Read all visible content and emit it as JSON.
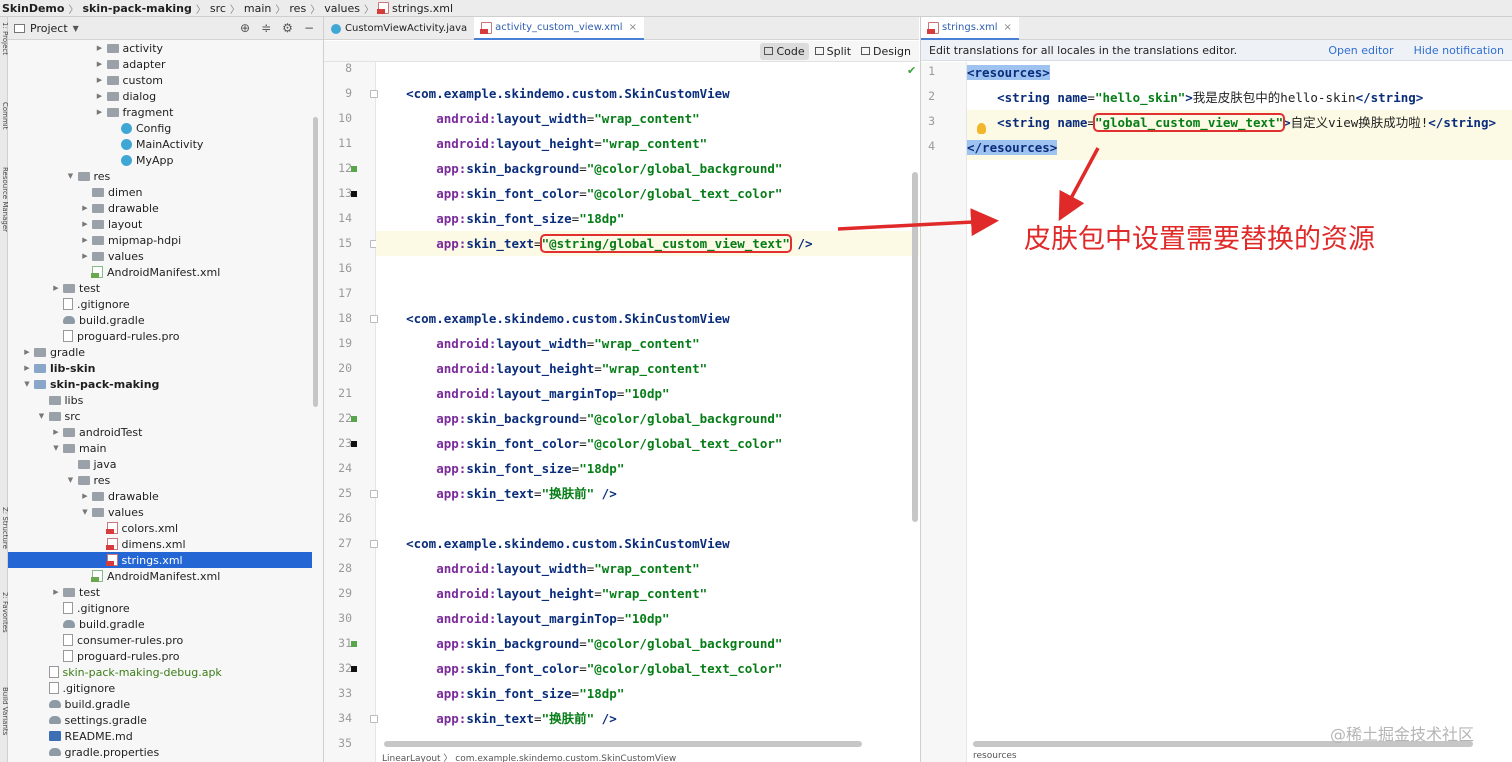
{
  "breadcrumb": [
    "SkinDemo",
    "skin-pack-making",
    "src",
    "main",
    "res",
    "values",
    "strings.xml"
  ],
  "left_strip": [
    "1: Project",
    "Commit",
    "Resource Manager",
    "Z: Structure",
    "2: Favorites",
    "Build Variants"
  ],
  "project_panel": {
    "title": "Project",
    "tree": [
      {
        "label": "activity",
        "indent": 5,
        "arrow": "▶",
        "icon": "folder"
      },
      {
        "label": "adapter",
        "indent": 5,
        "arrow": "▶",
        "icon": "folder"
      },
      {
        "label": "custom",
        "indent": 5,
        "arrow": "▶",
        "icon": "folder"
      },
      {
        "label": "dialog",
        "indent": 5,
        "arrow": "▶",
        "icon": "folder"
      },
      {
        "label": "fragment",
        "indent": 5,
        "arrow": "▶",
        "icon": "folder"
      },
      {
        "label": "Config",
        "indent": 6,
        "arrow": "",
        "icon": "class"
      },
      {
        "label": "MainActivity",
        "indent": 6,
        "arrow": "",
        "icon": "class"
      },
      {
        "label": "MyApp",
        "indent": 6,
        "arrow": "",
        "icon": "class"
      },
      {
        "label": "res",
        "indent": 3,
        "arrow": "▼",
        "icon": "folder"
      },
      {
        "label": "dimen",
        "indent": 4,
        "arrow": "",
        "icon": "folder"
      },
      {
        "label": "drawable",
        "indent": 4,
        "arrow": "▶",
        "icon": "folder"
      },
      {
        "label": "layout",
        "indent": 4,
        "arrow": "▶",
        "icon": "folder"
      },
      {
        "label": "mipmap-hdpi",
        "indent": 4,
        "arrow": "▶",
        "icon": "folder"
      },
      {
        "label": "values",
        "indent": 4,
        "arrow": "▶",
        "icon": "folder"
      },
      {
        "label": "AndroidManifest.xml",
        "indent": 4,
        "arrow": "",
        "icon": "manifest"
      },
      {
        "label": "test",
        "indent": 2,
        "arrow": "▶",
        "icon": "folder"
      },
      {
        "label": ".gitignore",
        "indent": 2,
        "arrow": "",
        "icon": "file"
      },
      {
        "label": "build.gradle",
        "indent": 2,
        "arrow": "",
        "icon": "gradle"
      },
      {
        "label": "proguard-rules.pro",
        "indent": 2,
        "arrow": "",
        "icon": "file"
      },
      {
        "label": "gradle",
        "indent": 0,
        "arrow": "▶",
        "icon": "folder"
      },
      {
        "label": "lib-skin",
        "indent": 0,
        "arrow": "▶",
        "icon": "folderm",
        "bold": true
      },
      {
        "label": "skin-pack-making",
        "indent": 0,
        "arrow": "▼",
        "icon": "folderm",
        "bold": true
      },
      {
        "label": "libs",
        "indent": 1,
        "arrow": "",
        "icon": "folder"
      },
      {
        "label": "src",
        "indent": 1,
        "arrow": "▼",
        "icon": "folder"
      },
      {
        "label": "androidTest",
        "indent": 2,
        "arrow": "▶",
        "icon": "folder"
      },
      {
        "label": "main",
        "indent": 2,
        "arrow": "▼",
        "icon": "folder"
      },
      {
        "label": "java",
        "indent": 3,
        "arrow": "",
        "icon": "folder"
      },
      {
        "label": "res",
        "indent": 3,
        "arrow": "▼",
        "icon": "folder"
      },
      {
        "label": "drawable",
        "indent": 4,
        "arrow": "▶",
        "icon": "folder"
      },
      {
        "label": "values",
        "indent": 4,
        "arrow": "▼",
        "icon": "folder"
      },
      {
        "label": "colors.xml",
        "indent": 5,
        "arrow": "",
        "icon": "xml"
      },
      {
        "label": "dimens.xml",
        "indent": 5,
        "arrow": "",
        "icon": "xml"
      },
      {
        "label": "strings.xml",
        "indent": 5,
        "arrow": "",
        "icon": "xml",
        "selected": true
      },
      {
        "label": "AndroidManifest.xml",
        "indent": 4,
        "arrow": "",
        "icon": "manifest"
      },
      {
        "label": "test",
        "indent": 2,
        "arrow": "▶",
        "icon": "folder"
      },
      {
        "label": ".gitignore",
        "indent": 2,
        "arrow": "",
        "icon": "file"
      },
      {
        "label": "build.gradle",
        "indent": 2,
        "arrow": "",
        "icon": "gradle"
      },
      {
        "label": "consumer-rules.pro",
        "indent": 2,
        "arrow": "",
        "icon": "file"
      },
      {
        "label": "proguard-rules.pro",
        "indent": 2,
        "arrow": "",
        "icon": "file"
      },
      {
        "label": "skin-pack-making-debug.apk",
        "indent": 1,
        "arrow": "",
        "icon": "file",
        "green": true
      },
      {
        "label": ".gitignore",
        "indent": 1,
        "arrow": "",
        "icon": "file"
      },
      {
        "label": "build.gradle",
        "indent": 1,
        "arrow": "",
        "icon": "gradle"
      },
      {
        "label": "settings.gradle",
        "indent": 1,
        "arrow": "",
        "icon": "gradle"
      },
      {
        "label": "README.md",
        "indent": 1,
        "arrow": "",
        "icon": "md"
      },
      {
        "label": "gradle.properties",
        "indent": 1,
        "arrow": "",
        "icon": "gradle"
      }
    ]
  },
  "editor": {
    "tabs": [
      {
        "label": "CustomViewActivity.java",
        "active": false,
        "icon": "java"
      },
      {
        "label": "activity_custom_view.xml",
        "active": true,
        "icon": "xml"
      }
    ],
    "modes": [
      "Code",
      "Split",
      "Design"
    ],
    "active_mode": "Code",
    "lines": [
      {
        "n": "8",
        "parts": []
      },
      {
        "n": "9",
        "parts": [
          [
            "tag",
            "    <com.example.skindemo.custom.SkinCustomView"
          ]
        ]
      },
      {
        "n": "10",
        "parts": [
          [
            "ns",
            "        android:"
          ],
          [
            "attr",
            "layout_width"
          ],
          [
            "txt",
            "="
          ],
          [
            "val",
            "\"wrap_content\""
          ]
        ]
      },
      {
        "n": "11",
        "parts": [
          [
            "ns",
            "        android:"
          ],
          [
            "attr",
            "layout_height"
          ],
          [
            "txt",
            "="
          ],
          [
            "val",
            "\"wrap_content\""
          ]
        ]
      },
      {
        "n": "12",
        "parts": [
          [
            "ns",
            "        app:"
          ],
          [
            "attr",
            "skin_background"
          ],
          [
            "txt",
            "="
          ],
          [
            "val",
            "\"@color/global_background\""
          ]
        ],
        "marker": "green"
      },
      {
        "n": "13",
        "parts": [
          [
            "ns",
            "        app:"
          ],
          [
            "attr",
            "skin_font_color"
          ],
          [
            "txt",
            "="
          ],
          [
            "val",
            "\"@color/global_text_color\""
          ]
        ],
        "marker": "black"
      },
      {
        "n": "14",
        "parts": [
          [
            "ns",
            "        app:"
          ],
          [
            "attr",
            "skin_font_size"
          ],
          [
            "txt",
            "="
          ],
          [
            "val",
            "\"18dp\""
          ]
        ]
      },
      {
        "n": "15",
        "parts": [
          [
            "ns",
            "        app:"
          ],
          [
            "attr",
            "skin_text"
          ],
          [
            "txt",
            "="
          ],
          [
            "val box",
            "\"@string/global_custom_view_text\""
          ],
          [
            "tag",
            " />"
          ]
        ],
        "current": true
      },
      {
        "n": "16",
        "parts": []
      },
      {
        "n": "17",
        "parts": []
      },
      {
        "n": "18",
        "parts": [
          [
            "tag",
            "    <com.example.skindemo.custom.SkinCustomView"
          ]
        ]
      },
      {
        "n": "19",
        "parts": [
          [
            "ns",
            "        android:"
          ],
          [
            "attr",
            "layout_width"
          ],
          [
            "txt",
            "="
          ],
          [
            "val",
            "\"wrap_content\""
          ]
        ]
      },
      {
        "n": "20",
        "parts": [
          [
            "ns",
            "        android:"
          ],
          [
            "attr",
            "layout_height"
          ],
          [
            "txt",
            "="
          ],
          [
            "val",
            "\"wrap_content\""
          ]
        ]
      },
      {
        "n": "21",
        "parts": [
          [
            "ns",
            "        android:"
          ],
          [
            "attr",
            "layout_marginTop"
          ],
          [
            "txt",
            "="
          ],
          [
            "val",
            "\"10dp\""
          ]
        ]
      },
      {
        "n": "22",
        "parts": [
          [
            "ns",
            "        app:"
          ],
          [
            "attr",
            "skin_background"
          ],
          [
            "txt",
            "="
          ],
          [
            "val",
            "\"@color/global_background\""
          ]
        ],
        "marker": "green"
      },
      {
        "n": "23",
        "parts": [
          [
            "ns",
            "        app:"
          ],
          [
            "attr",
            "skin_font_color"
          ],
          [
            "txt",
            "="
          ],
          [
            "val",
            "\"@color/global_text_color\""
          ]
        ],
        "marker": "black"
      },
      {
        "n": "24",
        "parts": [
          [
            "ns",
            "        app:"
          ],
          [
            "attr",
            "skin_font_size"
          ],
          [
            "txt",
            "="
          ],
          [
            "val",
            "\"18dp\""
          ]
        ]
      },
      {
        "n": "25",
        "parts": [
          [
            "ns",
            "        app:"
          ],
          [
            "attr",
            "skin_text"
          ],
          [
            "txt",
            "="
          ],
          [
            "val",
            "\"换肤前\""
          ],
          [
            "tag",
            " />"
          ]
        ]
      },
      {
        "n": "26",
        "parts": []
      },
      {
        "n": "27",
        "parts": [
          [
            "tag",
            "    <com.example.skindemo.custom.SkinCustomView"
          ]
        ]
      },
      {
        "n": "28",
        "parts": [
          [
            "ns",
            "        android:"
          ],
          [
            "attr",
            "layout_width"
          ],
          [
            "txt",
            "="
          ],
          [
            "val",
            "\"wrap_content\""
          ]
        ]
      },
      {
        "n": "29",
        "parts": [
          [
            "ns",
            "        android:"
          ],
          [
            "attr",
            "layout_height"
          ],
          [
            "txt",
            "="
          ],
          [
            "val",
            "\"wrap_content\""
          ]
        ]
      },
      {
        "n": "30",
        "parts": [
          [
            "ns",
            "        android:"
          ],
          [
            "attr",
            "layout_marginTop"
          ],
          [
            "txt",
            "="
          ],
          [
            "val",
            "\"10dp\""
          ]
        ]
      },
      {
        "n": "31",
        "parts": [
          [
            "ns",
            "        app:"
          ],
          [
            "attr",
            "skin_background"
          ],
          [
            "txt",
            "="
          ],
          [
            "val",
            "\"@color/global_background\""
          ]
        ],
        "marker": "green"
      },
      {
        "n": "32",
        "parts": [
          [
            "ns",
            "        app:"
          ],
          [
            "attr",
            "skin_font_color"
          ],
          [
            "txt",
            "="
          ],
          [
            "val",
            "\"@color/global_text_color\""
          ]
        ],
        "marker": "black"
      },
      {
        "n": "33",
        "parts": [
          [
            "ns",
            "        app:"
          ],
          [
            "attr",
            "skin_font_size"
          ],
          [
            "txt",
            "="
          ],
          [
            "val",
            "\"18dp\""
          ]
        ]
      },
      {
        "n": "34",
        "parts": [
          [
            "ns",
            "        app:"
          ],
          [
            "attr",
            "skin_text"
          ],
          [
            "txt",
            "="
          ],
          [
            "val",
            "\"换肤前\""
          ],
          [
            "tag",
            " />"
          ]
        ]
      },
      {
        "n": "35",
        "parts": []
      }
    ],
    "status_crumb": "LinearLayout  〉 com.example.skindemo.custom.SkinCustomView"
  },
  "right": {
    "tab": "strings.xml",
    "notification": "Edit translations for all locales in the translations editor.",
    "open_editor": "Open editor",
    "hide_notification": "Hide notification",
    "lines": [
      {
        "n": "1",
        "parts": [
          [
            "tag hl",
            "<resources>"
          ]
        ]
      },
      {
        "n": "2",
        "parts": [
          [
            "tag",
            "    <string "
          ],
          [
            "attr",
            "name"
          ],
          [
            "txt",
            "="
          ],
          [
            "val",
            "\"hello_skin\""
          ],
          [
            "tag",
            ">"
          ],
          [
            "txt",
            "我是皮肤包中的hello-skin"
          ],
          [
            "tag",
            "</string>"
          ]
        ]
      },
      {
        "n": "3",
        "parts": [
          [
            "tag",
            "    <string "
          ],
          [
            "attr",
            "name"
          ],
          [
            "txt",
            "="
          ],
          [
            "val box",
            "\"global_custom_view_text\""
          ],
          [
            "tag",
            ">"
          ],
          [
            "txt",
            "自定义view换肤成功啦!"
          ],
          [
            "tag",
            "</string>"
          ]
        ],
        "current": true
      },
      {
        "n": "4",
        "parts": [
          [
            "tag hl",
            "</resources>"
          ]
        ],
        "current": true
      }
    ],
    "status_crumb": "resources"
  },
  "annotation": "皮肤包中设置需要替换的资源",
  "watermark": "@稀土掘金技术社区",
  "colors": {
    "annotation_red": "#e02a2a",
    "selection": "#2466d4",
    "tag": "#0a2d7b",
    "value": "#067d17",
    "namespace": "#7a2a9a"
  }
}
